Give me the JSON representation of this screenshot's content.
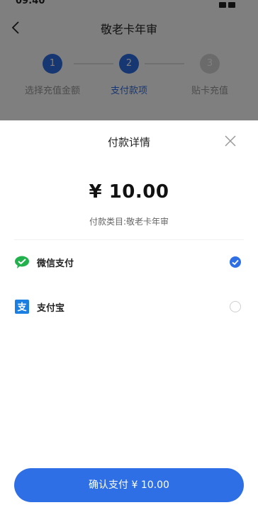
{
  "status": {
    "time": "09:40"
  },
  "nav": {
    "title": "敬老卡年审"
  },
  "steps": [
    {
      "number": "1",
      "label": "选择充值金额",
      "state": "done"
    },
    {
      "number": "2",
      "label": "支付款项",
      "state": "active"
    },
    {
      "number": "3",
      "label": "贴卡充值",
      "state": "inactive"
    }
  ],
  "sheet": {
    "title": "付款详情",
    "amount": "¥ 10.00",
    "description": "付款类目:敬老卡年审",
    "methods": [
      {
        "label": "微信支付",
        "icon": "wechat-pay-icon",
        "selected": true
      },
      {
        "label": "支付宝",
        "icon": "alipay-icon",
        "selected": false
      }
    ],
    "confirm_label": "确认支付 ¥ 10.00"
  },
  "colors": {
    "accent": "#2f6fe6",
    "wechat": "#21b14d",
    "alipay": "#1a7fe0"
  }
}
